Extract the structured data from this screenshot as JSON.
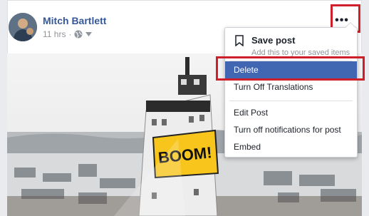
{
  "post": {
    "author": "Mitch Bartlett",
    "time": "11 hrs",
    "separator": "·",
    "more_label": "•••"
  },
  "photo": {
    "sign_text": "BOOM!"
  },
  "menu": {
    "save_title": "Save post",
    "save_subtitle": "Add this to your saved items",
    "items": [
      {
        "label": "Delete",
        "highlighted": true
      },
      {
        "label": "Turn Off Translations"
      },
      {
        "label": "Edit Post"
      },
      {
        "label": "Turn off notifications for post"
      },
      {
        "label": "Embed"
      }
    ]
  },
  "colors": {
    "author_link": "#365899",
    "menu_highlight": "#4267b2",
    "annotation_border": "#cf1f2a"
  }
}
